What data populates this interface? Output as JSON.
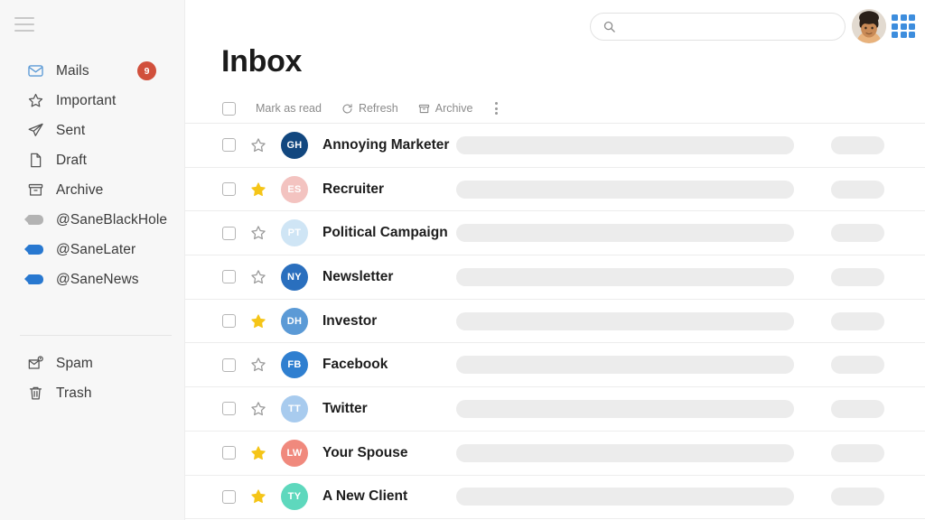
{
  "sidebar": {
    "menu_icon": "hamburger-icon",
    "top_items": [
      {
        "label": "Mails",
        "icon": "envelope-icon",
        "badge": "9",
        "active": true
      },
      {
        "label": "Important",
        "icon": "star-outline-icon",
        "badge": ""
      },
      {
        "label": "Sent",
        "icon": "paper-plane-icon",
        "badge": ""
      },
      {
        "label": "Draft",
        "icon": "document-icon",
        "badge": ""
      },
      {
        "label": "Archive",
        "icon": "archive-box-icon",
        "badge": ""
      },
      {
        "label": "@SaneBlackHole",
        "icon": "tag-icon",
        "badge": "",
        "tag_color": "#b3b3b3"
      },
      {
        "label": "@SaneLater",
        "icon": "tag-icon",
        "badge": "",
        "tag_color": "#2878d0"
      },
      {
        "label": "@SaneNews",
        "icon": "tag-icon",
        "badge": "",
        "tag_color": "#2878d0"
      }
    ],
    "bottom_items": [
      {
        "label": "Spam",
        "icon": "spam-envelope-icon"
      },
      {
        "label": "Trash",
        "icon": "trash-icon"
      }
    ],
    "badge_color": "#d1503c"
  },
  "header": {
    "search": {
      "placeholder": "",
      "value": "",
      "icon": "search-icon"
    },
    "avatar": "user-avatar-photo",
    "apps": "apps-grid-icon",
    "apps_color": "#3d8ddd"
  },
  "main": {
    "title": "Inbox",
    "toolbar": {
      "select_all": "select-all-checkbox",
      "mark_as_read": "Mark as read",
      "refresh": "Refresh",
      "archive": "Archive",
      "more": "more-options-icon"
    }
  },
  "emails": [
    {
      "name": "Annoying Marketer",
      "initials": "GH",
      "avatar_bg": "#12477f",
      "avatar_fg": "#ffffff",
      "starred": false,
      "checked": false
    },
    {
      "name": "Recruiter",
      "initials": "ES",
      "avatar_bg": "#f3c3c0",
      "avatar_fg": "#ffffff",
      "starred": true,
      "checked": false
    },
    {
      "name": "Political Campaign",
      "initials": "PT",
      "avatar_bg": "#cfe5f5",
      "avatar_fg": "#ffffff",
      "starred": false,
      "checked": false
    },
    {
      "name": "Newsletter",
      "initials": "NY",
      "avatar_bg": "#2a6fbe",
      "avatar_fg": "#ffffff",
      "starred": false,
      "checked": false
    },
    {
      "name": "Investor",
      "initials": "DH",
      "avatar_bg": "#5b9ad6",
      "avatar_fg": "#ffffff",
      "starred": true,
      "checked": false
    },
    {
      "name": "Facebook",
      "initials": "FB",
      "avatar_bg": "#2f7fd0",
      "avatar_fg": "#ffffff",
      "starred": false,
      "checked": false
    },
    {
      "name": "Twitter",
      "initials": "TT",
      "avatar_bg": "#a8cbee",
      "avatar_fg": "#ffffff",
      "starred": false,
      "checked": false
    },
    {
      "name": "Your Spouse",
      "initials": "LW",
      "avatar_bg": "#f0897d",
      "avatar_fg": "#ffffff",
      "starred": true,
      "checked": false
    },
    {
      "name": "A New Client",
      "initials": "TY",
      "avatar_bg": "#5ed8bd",
      "avatar_fg": "#ffffff",
      "starred": true,
      "checked": false
    }
  ],
  "colors": {
    "star_filled": "#f5c518",
    "star_outline": "#9a9a9a",
    "skeleton": "#ececec",
    "sidebar_bg": "#f7f7f7"
  }
}
